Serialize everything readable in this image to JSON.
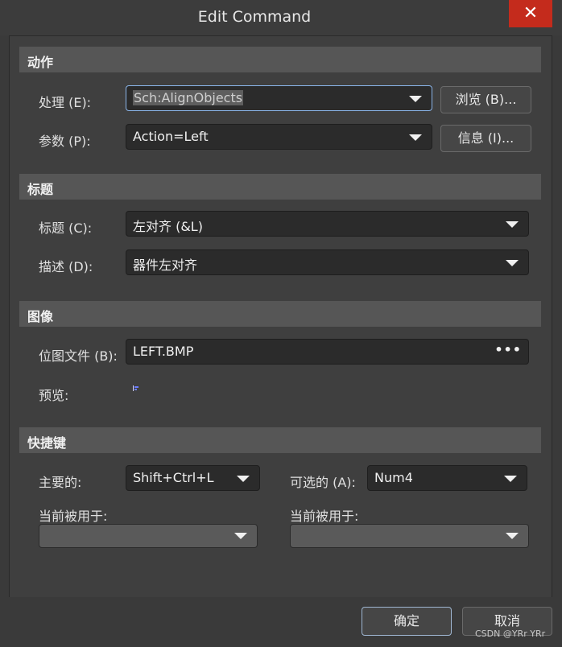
{
  "window": {
    "title": "Edit Command",
    "close_glyph": "✕"
  },
  "sections": {
    "action": "动作",
    "caption": "标题",
    "image": "图像",
    "shortcuts": "快捷键"
  },
  "action": {
    "process_label": "处理 (E):",
    "process_value": "Sch:AlignObjects",
    "browse_button": "浏览 (B)...",
    "params_label": "参数 (P):",
    "params_value": "Action=Left",
    "info_button": "信息 (I)..."
  },
  "caption": {
    "title_label": "标题 (C):",
    "title_value": "左对齐 (&L)",
    "desc_label": "描述 (D):",
    "desc_value": "器件左对齐"
  },
  "image": {
    "bitmap_label": "位图文件 (B):",
    "bitmap_value": "LEFT.BMP",
    "ellipsis": "•••",
    "preview_label": "预览:",
    "preview_icon": "align-left-icon"
  },
  "shortcuts": {
    "primary_label": "主要的:",
    "primary_value": "Shift+Ctrl+L",
    "alternate_label": "可选的 (A):",
    "alternate_value": "Num4",
    "used_by_left_label": "当前被用于:",
    "used_by_left_value": "",
    "used_by_right_label": "当前被用于:",
    "used_by_right_value": ""
  },
  "footer": {
    "ok_button": "确定",
    "cancel_button": "取消",
    "watermark": "CSDN @YRr YRr"
  },
  "colors": {
    "background": "#3a3a3a",
    "section_band": "#565656",
    "field": "#2b2b2b",
    "close_button": "#c42b1c",
    "focus_border": "#8ab4e8"
  }
}
